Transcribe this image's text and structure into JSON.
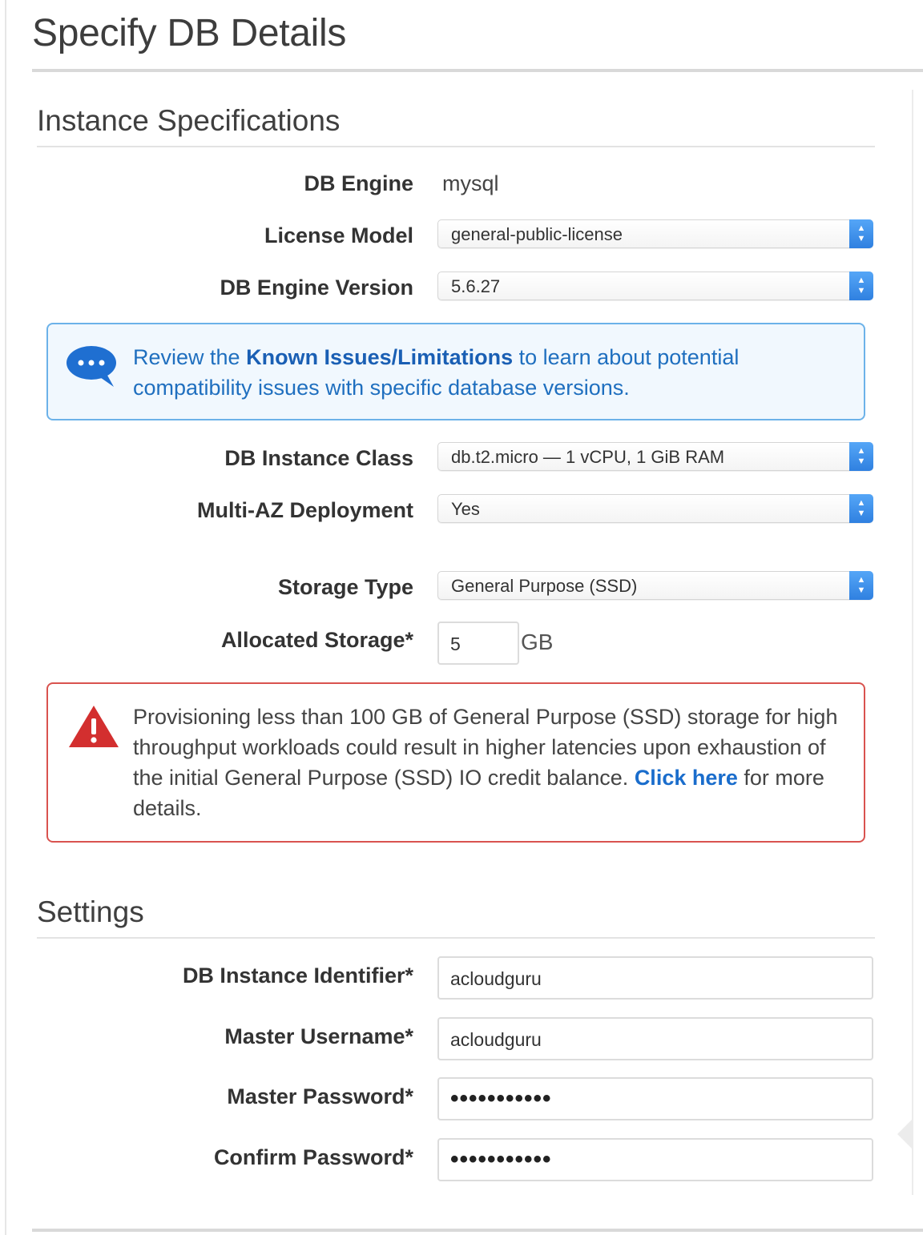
{
  "page": {
    "title": "Specify DB Details"
  },
  "instance_specs": {
    "title": "Instance Specifications",
    "db_engine": {
      "label": "DB Engine",
      "value": "mysql"
    },
    "license_model": {
      "label": "License Model",
      "value": "general-public-license"
    },
    "engine_version": {
      "label": "DB Engine Version",
      "value": "5.6.27"
    },
    "info_notice": {
      "prefix": "Review the ",
      "link": "Known Issues/Limitations",
      "suffix": " to learn about potential compatibility issues with specific database versions.",
      "icon": "speech-bubble-icon"
    },
    "instance_class": {
      "label": "DB Instance Class",
      "value": "db.t2.micro — 1 vCPU, 1 GiB RAM"
    },
    "multi_az": {
      "label": "Multi-AZ Deployment",
      "value": "Yes"
    },
    "storage_type": {
      "label": "Storage Type",
      "value": "General Purpose (SSD)"
    },
    "allocated_storage": {
      "label": "Allocated Storage*",
      "value": "5",
      "unit": "GB"
    },
    "warning": {
      "text": "Provisioning less than 100 GB of General Purpose (SSD) storage for high throughput workloads could result in higher latencies upon exhaustion of the initial General Purpose (SSD) IO credit balance. ",
      "link": "Click here",
      "suffix": " for more details.",
      "icon": "warning-triangle-icon"
    }
  },
  "settings": {
    "title": "Settings",
    "identifier": {
      "label": "DB Instance Identifier*",
      "value": "acloudguru"
    },
    "master_username": {
      "label": "Master Username*",
      "value": "acloudguru"
    },
    "master_password": {
      "label": "Master Password*",
      "value": "•••••••••••"
    },
    "confirm_password": {
      "label": "Confirm Password*",
      "value": "•••••••••••"
    }
  },
  "colors": {
    "accent_blue": "#2f80e0",
    "info_border": "#6cb2e9",
    "warning_red": "#d9534f"
  }
}
